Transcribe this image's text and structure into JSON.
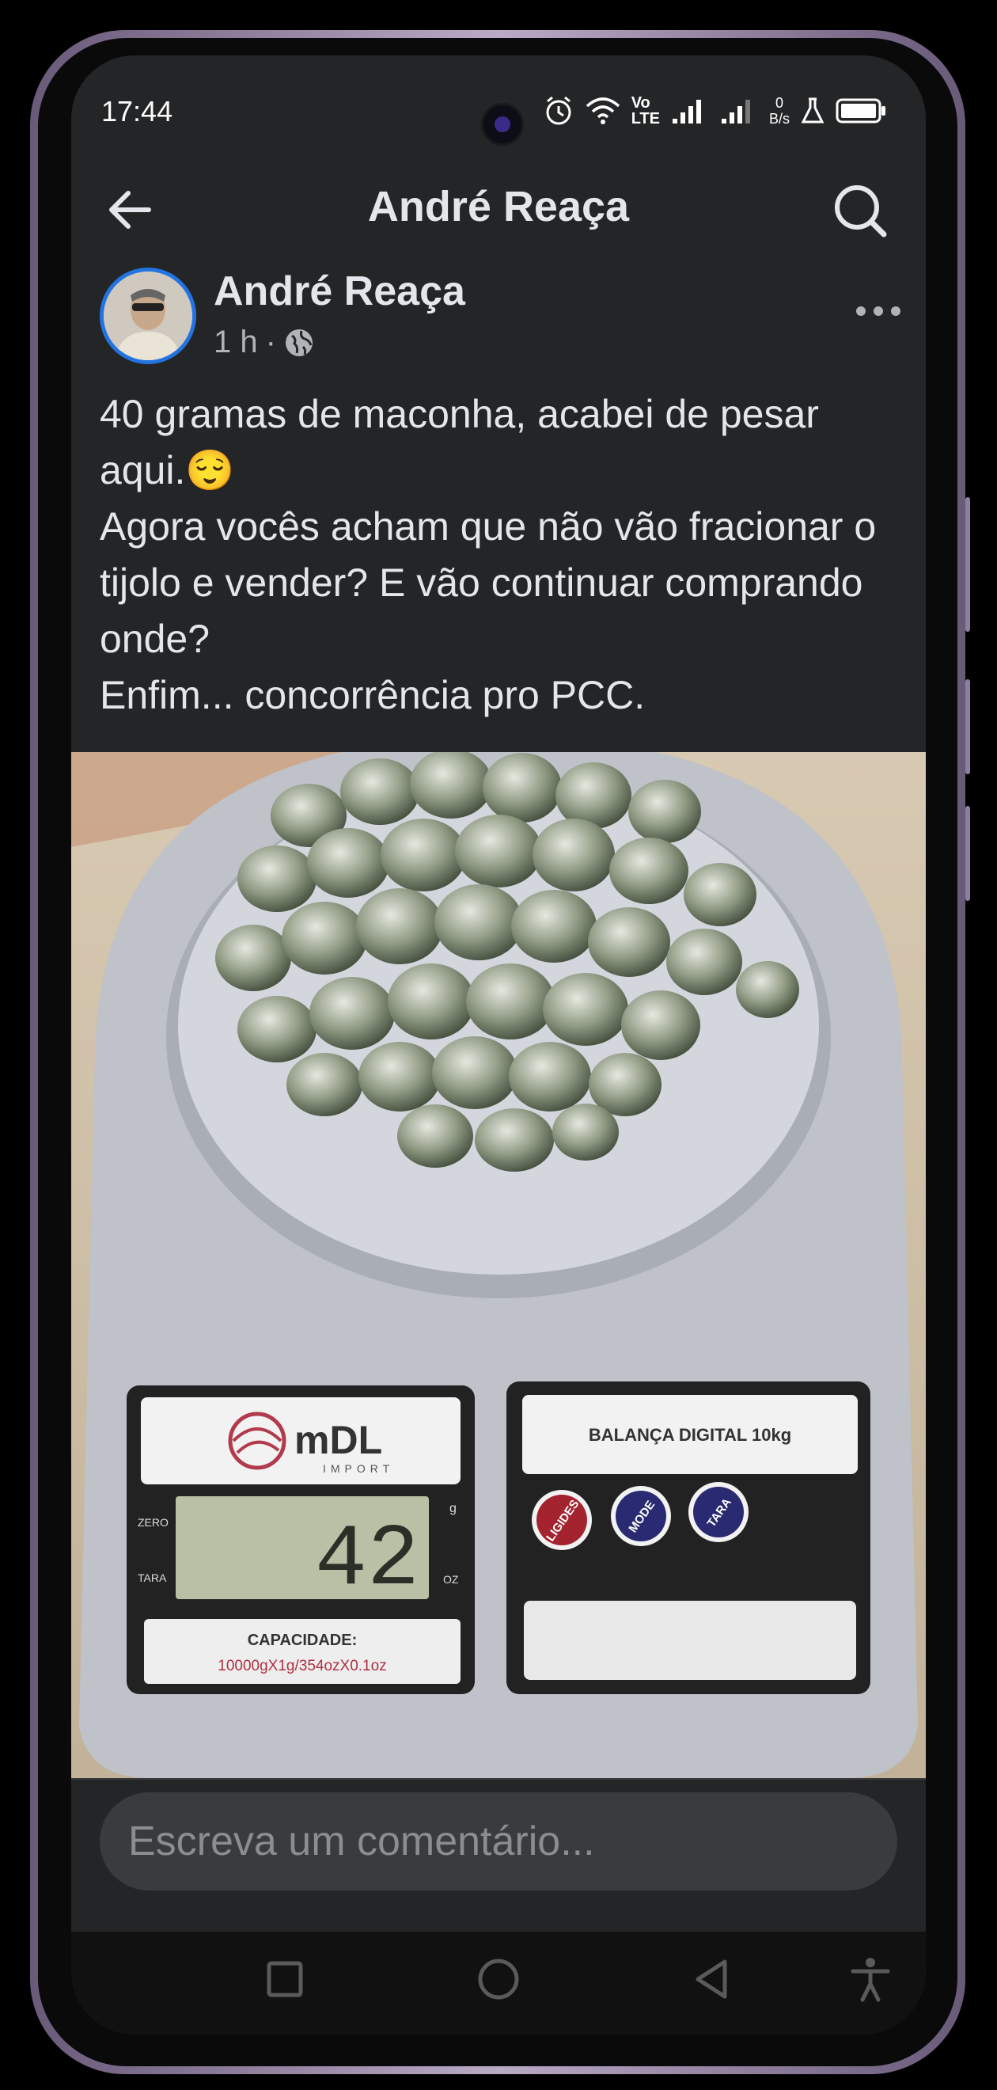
{
  "status_bar": {
    "time": "17:44",
    "net_speed_value": "0",
    "net_speed_unit": "B/s",
    "volte_top": "Vo",
    "volte_bottom": "LTE"
  },
  "header": {
    "title": "André Reaça"
  },
  "post": {
    "author": "André Reaça",
    "time": "1 h",
    "separator": "·",
    "lines": [
      "40 gramas de maconha, acabei de pesar aqui.😌",
      "Agora vocês acham que não vão fracionar o tijolo e vender? E vão continuar comprando onde?",
      "Enfim... concorrência pro PCC."
    ]
  },
  "photo": {
    "brand": "mDL",
    "brand_sub": "IMPORT",
    "display_value": "42",
    "label_zero": "ZERO",
    "label_tara": "TARA",
    "label_g": "g",
    "label_oz": "OZ",
    "capacity_title": "CAPACIDADE:",
    "capacity_value": "10000gX1g/354ozX0.1oz",
    "model": "BALANÇA DIGITAL 10kg",
    "btn_ligides": "LIGIDES",
    "btn_mode": "MODE",
    "btn_tara": "TARA"
  },
  "comment": {
    "placeholder": "Escreva um comentário..."
  },
  "icons": {
    "back": "back-arrow-icon",
    "search": "search-icon",
    "globe": "globe-icon",
    "more": "more-dots-icon",
    "alarm": "alarm-icon",
    "wifi": "wifi-icon",
    "battery": "battery-icon"
  },
  "colors": {
    "accent": "#2374e1",
    "background": "#242526",
    "text": "#e4e6eb",
    "secondary_text": "#b0b3b8"
  }
}
